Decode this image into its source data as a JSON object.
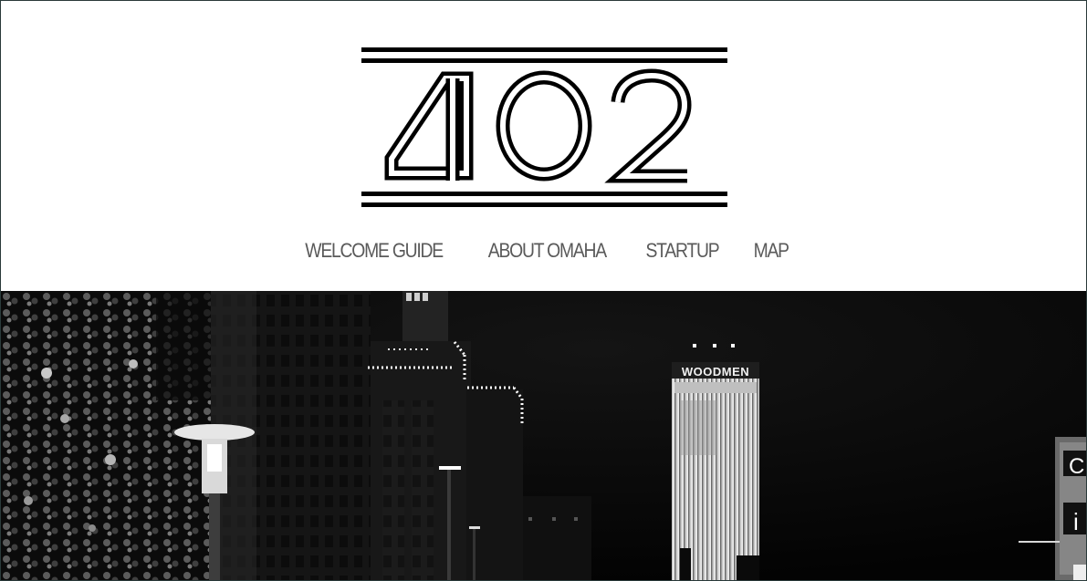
{
  "site": {
    "logo_text": "402"
  },
  "nav": {
    "items": [
      {
        "label": "WELCOME GUIDE"
      },
      {
        "label": "ABOUT OMAHA"
      },
      {
        "label": "STARTUP"
      },
      {
        "label": "MAP"
      }
    ]
  },
  "hero": {
    "building_sign": "WOODMEN"
  },
  "colors": {
    "nav_text": "#5a5a5a",
    "header_bg": "#ffffff",
    "hero_bg": "#050505",
    "logo": "#000000"
  }
}
